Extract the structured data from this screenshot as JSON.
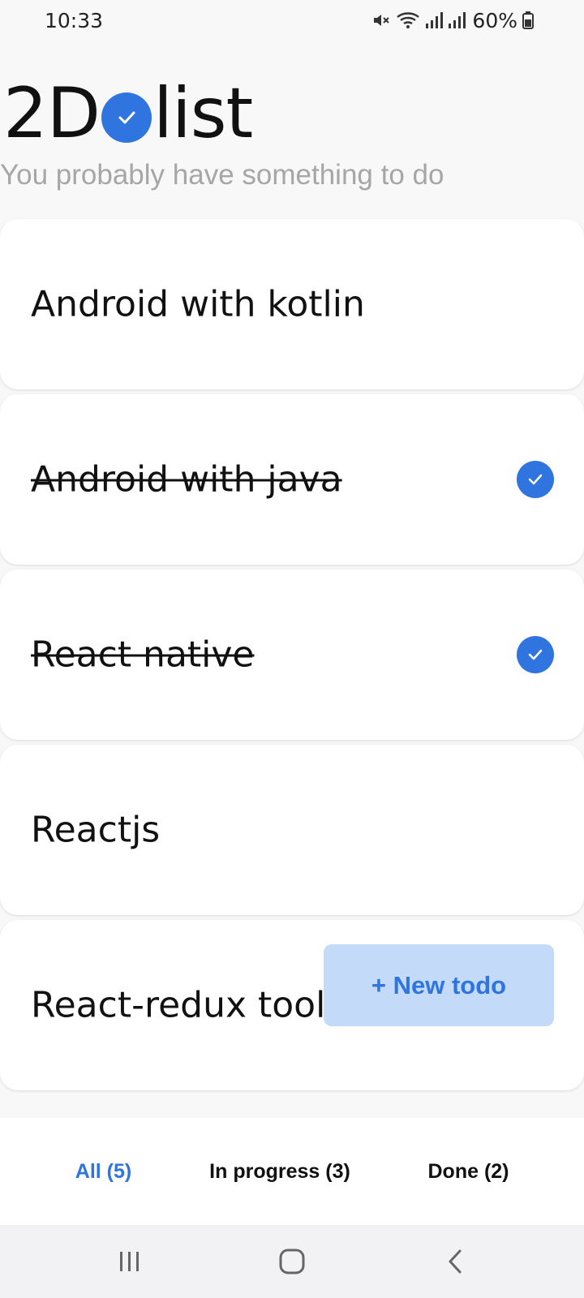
{
  "status_bar": {
    "time": "10:33",
    "battery": "60%",
    "icons": [
      "mute-icon",
      "wifi-icon",
      "signal-icon",
      "signal-icon",
      "battery-icon"
    ]
  },
  "header": {
    "logo_left": "2D",
    "logo_right": "list",
    "subtitle": "You probably have something to do"
  },
  "todos": [
    {
      "text": "Android with kotlin",
      "done": false
    },
    {
      "text": "Android with java",
      "done": true
    },
    {
      "text": "React native",
      "done": true
    },
    {
      "text": "Reactjs",
      "done": false
    },
    {
      "text": "React-redux toolkit",
      "done": false
    }
  ],
  "new_todo_button": "+ New todo",
  "tabs": [
    {
      "label": "All (5)",
      "active": true
    },
    {
      "label": "In progress (3)",
      "active": false
    },
    {
      "label": "Done (2)",
      "active": false
    }
  ],
  "colors": {
    "accent": "#2f74df",
    "button_bg": "#c3daf9",
    "subtitle": "#a6a6a6"
  }
}
